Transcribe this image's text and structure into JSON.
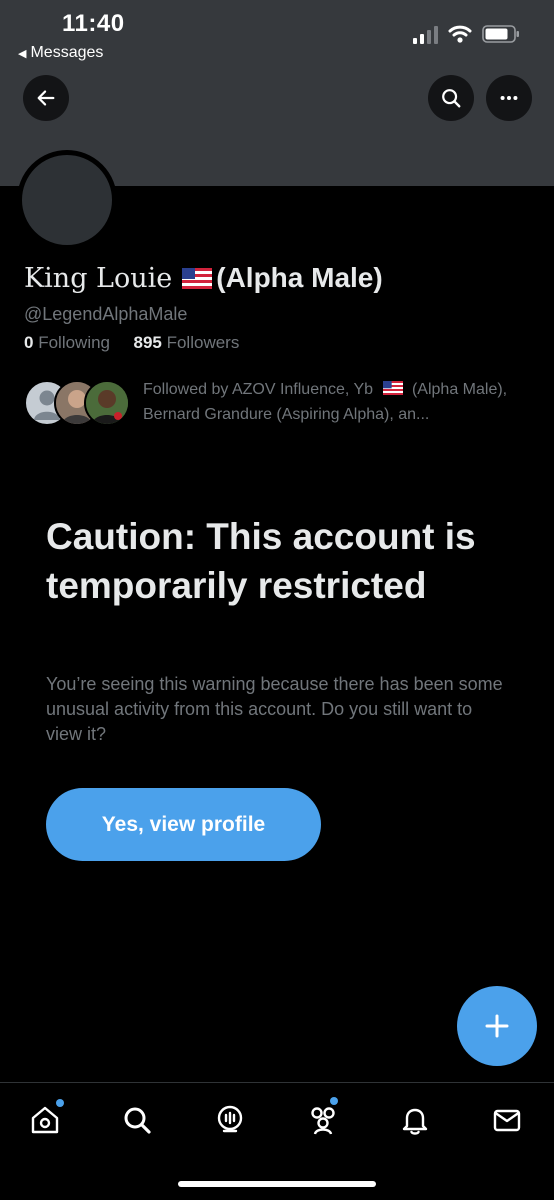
{
  "status_bar": {
    "time": "11:40",
    "back_app_label": "Messages",
    "signal_icon": "cellular-signal-icon",
    "wifi_icon": "wifi-icon",
    "battery_icon": "battery-icon"
  },
  "top_nav": {
    "back_icon": "arrow-left-icon",
    "search_icon": "search-icon",
    "more_icon": "more-horizontal-icon"
  },
  "profile": {
    "name": "King Louie",
    "name_flag": "us-flag-icon",
    "name_suffix": "(Alpha Male)",
    "handle": "@LegendAlphaMale",
    "following_count": "0",
    "following_label": "Following",
    "followers_count": "895",
    "followers_label": "Followers"
  },
  "followed_by": {
    "text_before_flag": "Followed by AZOV Influence, Yb",
    "text_after_flag": "(Alpha Male), Bernard Grandure (Aspiring Alpha), an..."
  },
  "warning": {
    "title": "Caution: This account is temporarily restricted",
    "body": "You’re seeing this warning because there has been some unusual activity from this account. Do you still want to view it?",
    "button_label": "Yes, view profile"
  },
  "fab": {
    "icon": "plus-icon"
  },
  "tab_bar": {
    "items": [
      {
        "name": "home",
        "icon": "home-icon",
        "has_dot": true
      },
      {
        "name": "explore",
        "icon": "search-icon",
        "has_dot": false
      },
      {
        "name": "spaces",
        "icon": "spaces-icon",
        "has_dot": false
      },
      {
        "name": "communities",
        "icon": "communities-icon",
        "has_dot": true
      },
      {
        "name": "notifications",
        "icon": "bell-icon",
        "has_dot": false
      },
      {
        "name": "messages",
        "icon": "mail-icon",
        "has_dot": false
      }
    ]
  },
  "colors": {
    "accent": "#4ba1eb",
    "banner": "#36393d",
    "background": "#000000",
    "secondary_text": "#71767b",
    "primary_text": "#e7e9ea"
  }
}
